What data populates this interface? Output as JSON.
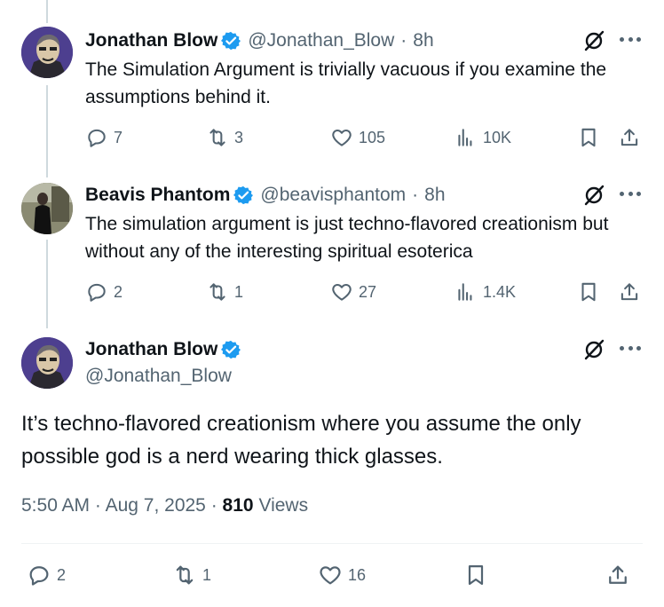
{
  "thread": [
    {
      "author": "Jonathan Blow",
      "handle": "@Jonathan_Blow",
      "separator": "·",
      "time": "8h",
      "text": "The Simulation Argument is trivially vacuous if you examine the assumptions behind it.",
      "replies": "7",
      "reposts": "3",
      "likes": "105",
      "views": "10K",
      "avatar": "jonathan-blow-cartoon-avatar"
    },
    {
      "author": "Beavis Phantom",
      "handle": "@beavisphantom",
      "separator": "·",
      "time": "8h",
      "text": "The simulation argument is just techno-flavored creationism but without any of the interesting spiritual esoterica",
      "replies": "2",
      "reposts": "1",
      "likes": "27",
      "views": "1.4K",
      "avatar": "beavis-phantom-photo-avatar"
    }
  ],
  "main": {
    "author": "Jonathan Blow",
    "handle": "@Jonathan_Blow",
    "text": "It’s techno-flavored creationism where you assume the only possible god is a nerd wearing thick glasses.",
    "time": "5:50 AM",
    "date": "Aug 7, 2025",
    "separator": "·",
    "views_count": "810",
    "views_label": "Views",
    "replies": "2",
    "reposts": "1",
    "likes": "16"
  },
  "colors": {
    "verified": "#1d9bf0",
    "secondary_text": "#536471",
    "primary_text": "#0f1419",
    "thread_line": "#cfd9de"
  }
}
